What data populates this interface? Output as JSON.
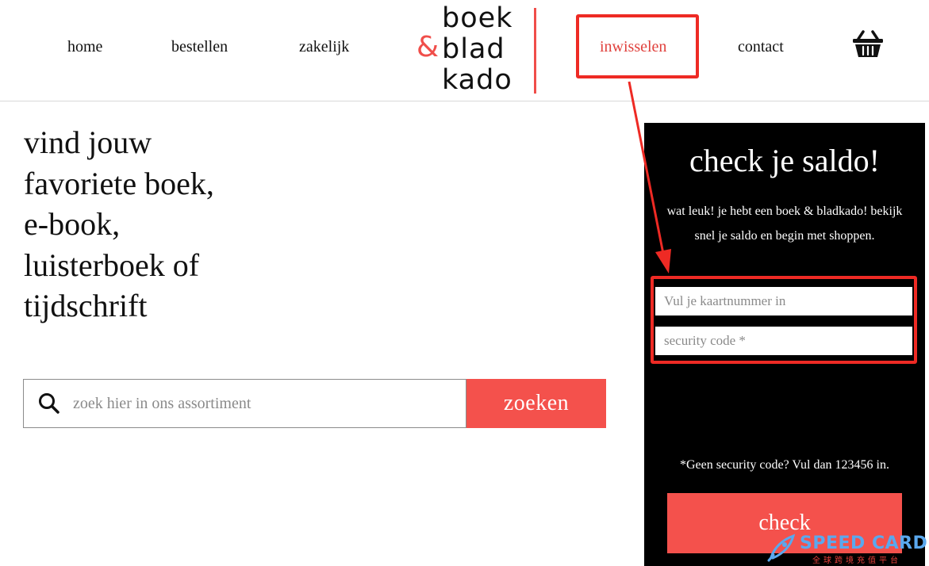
{
  "nav": {
    "home": "home",
    "bestellen": "bestellen",
    "zakelijk": "zakelijk",
    "inwisselen": "inwisselen",
    "contact": "contact",
    "cart_icon": "shopping-basket-icon"
  },
  "logo": {
    "line1": "boek",
    "ampersand": "&",
    "line2": "blad",
    "line3": "kado"
  },
  "hero": {
    "title_lines": [
      "vind jouw",
      "favoriete boek,",
      "e-book,",
      "luisterboek of",
      "tijdschrift"
    ]
  },
  "search": {
    "icon": "search-icon",
    "placeholder": "zoek hier in ons assortiment",
    "value": "",
    "button_label": "zoeken"
  },
  "saldo": {
    "title": "check je saldo!",
    "intro": "wat leuk! je hebt een boek & bladkado! bekijk snel je saldo en begin met shoppen.",
    "card_placeholder": "Vul je kaartnummer in",
    "code_placeholder": "security code *",
    "note": "*Geen security code? Vul dan 123456 in.",
    "button_label": "check"
  },
  "watermark": {
    "brand": "SPEED CARD",
    "sub": "全球跨境充值平台",
    "icon": "rocket-icon"
  },
  "colors": {
    "accent": "#f4514c",
    "annotation": "#ee2a24",
    "panel": "#000000"
  }
}
